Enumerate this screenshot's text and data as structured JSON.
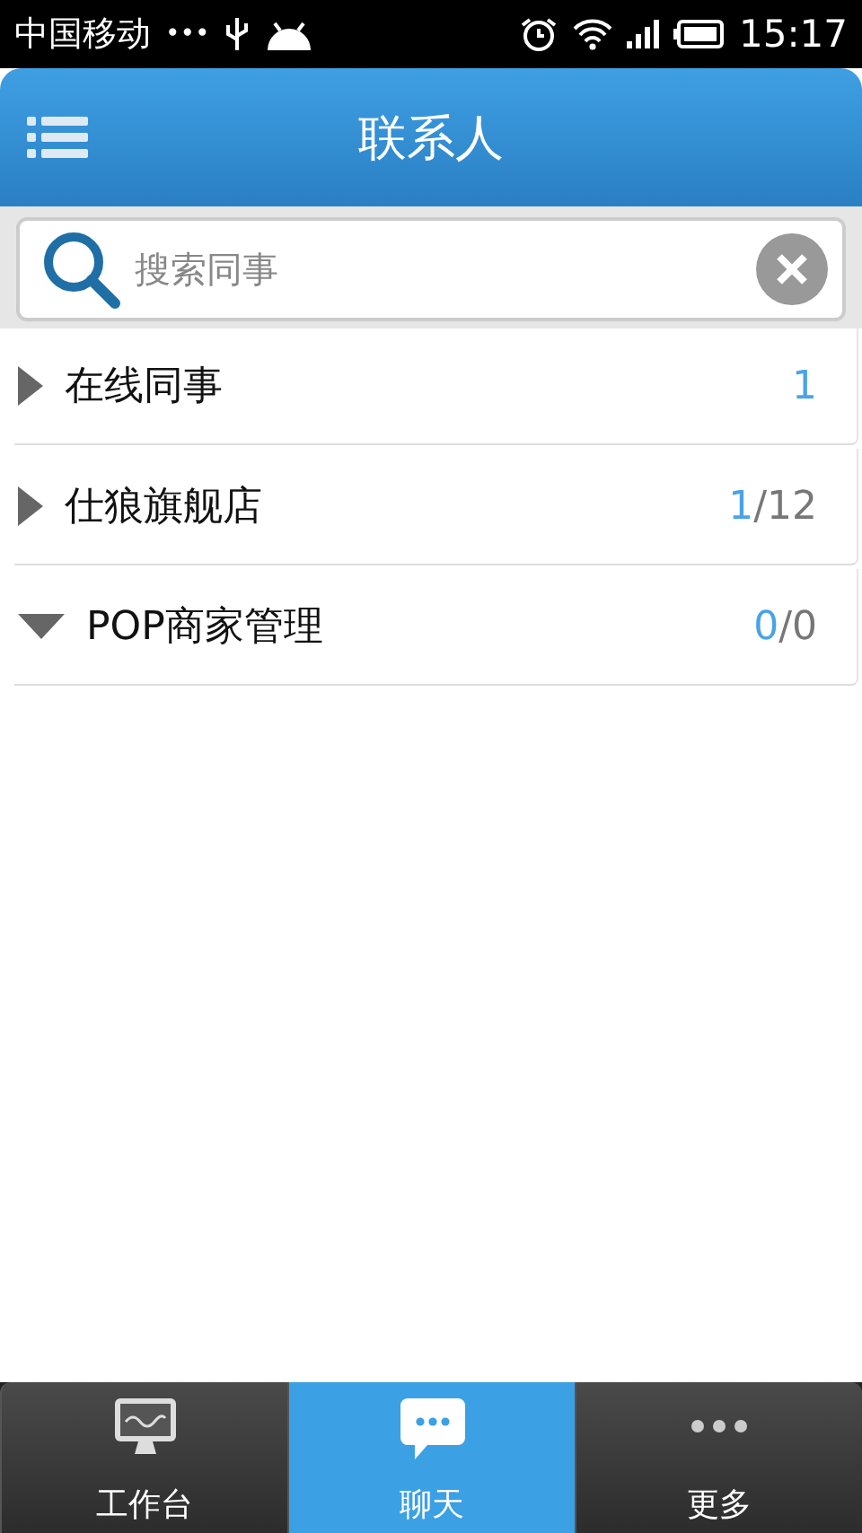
{
  "status_bar": {
    "carrier": "中国移动",
    "more": "•••",
    "time": "15:17"
  },
  "header": {
    "title": "联系人"
  },
  "search": {
    "placeholder": "搜索同事"
  },
  "groups": [
    {
      "name": "在线同事",
      "expanded": false,
      "online": "1"
    },
    {
      "name": "仕狼旗舰店",
      "expanded": false,
      "online": "1",
      "rest": "/12"
    },
    {
      "name": "POP商家管理",
      "expanded": true,
      "online": "0",
      "rest": "/0"
    }
  ],
  "tabs": [
    {
      "kind": "workbench",
      "label": "工作台",
      "selected": false
    },
    {
      "kind": "chat",
      "label": "聊天",
      "selected": true
    },
    {
      "kind": "more",
      "label": "更多",
      "selected": false
    }
  ]
}
